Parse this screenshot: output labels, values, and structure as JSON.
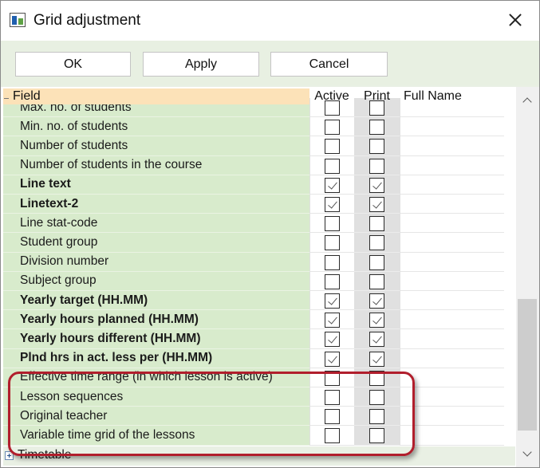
{
  "window": {
    "title": "Grid adjustment",
    "icon": "app-grid-icon",
    "close": "close-icon"
  },
  "toolbar": {
    "ok_label": "OK",
    "apply_label": "Apply",
    "cancel_label": "Cancel"
  },
  "columns": {
    "field": "Field",
    "active": "Active",
    "print": "Print",
    "full_name": "Full Name"
  },
  "rows": [
    {
      "label": "Max. no. of students",
      "bold": false,
      "active": false,
      "print": false
    },
    {
      "label": "Min. no. of students",
      "bold": false,
      "active": false,
      "print": false
    },
    {
      "label": "Number of students",
      "bold": false,
      "active": false,
      "print": false
    },
    {
      "label": "Number of students in the course",
      "bold": false,
      "active": false,
      "print": false
    },
    {
      "label": "Line text",
      "bold": true,
      "active": true,
      "print": true
    },
    {
      "label": "Linetext-2",
      "bold": true,
      "active": true,
      "print": true
    },
    {
      "label": "Line stat-code",
      "bold": false,
      "active": false,
      "print": false
    },
    {
      "label": "Student group",
      "bold": false,
      "active": false,
      "print": false
    },
    {
      "label": "Division number",
      "bold": false,
      "active": false,
      "print": false
    },
    {
      "label": "Subject group",
      "bold": false,
      "active": false,
      "print": false
    },
    {
      "label": "Yearly target (HH.MM)",
      "bold": true,
      "active": true,
      "print": true
    },
    {
      "label": "Yearly hours planned (HH.MM)",
      "bold": true,
      "active": true,
      "print": true
    },
    {
      "label": "Yearly hours different (HH.MM)",
      "bold": true,
      "active": true,
      "print": true
    },
    {
      "label": "Plnd hrs in act. less per (HH.MM)",
      "bold": true,
      "active": true,
      "print": true
    },
    {
      "label": "Effective time range (in which lesson is active)",
      "bold": false,
      "active": false,
      "print": false
    },
    {
      "label": "Lesson sequences",
      "bold": false,
      "active": false,
      "print": false
    },
    {
      "label": "Original teacher",
      "bold": false,
      "active": false,
      "print": false
    },
    {
      "label": "Variable time grid of the lessons",
      "bold": false,
      "active": false,
      "print": false
    }
  ],
  "footer": {
    "group_label": "Timetable",
    "expand": "plus-icon"
  },
  "colors": {
    "field_bg": "#d8ebcc",
    "header_field_bg": "#fce2b8",
    "highlight": "#b11e2c",
    "dialog_bg": "#e9f0e4"
  }
}
